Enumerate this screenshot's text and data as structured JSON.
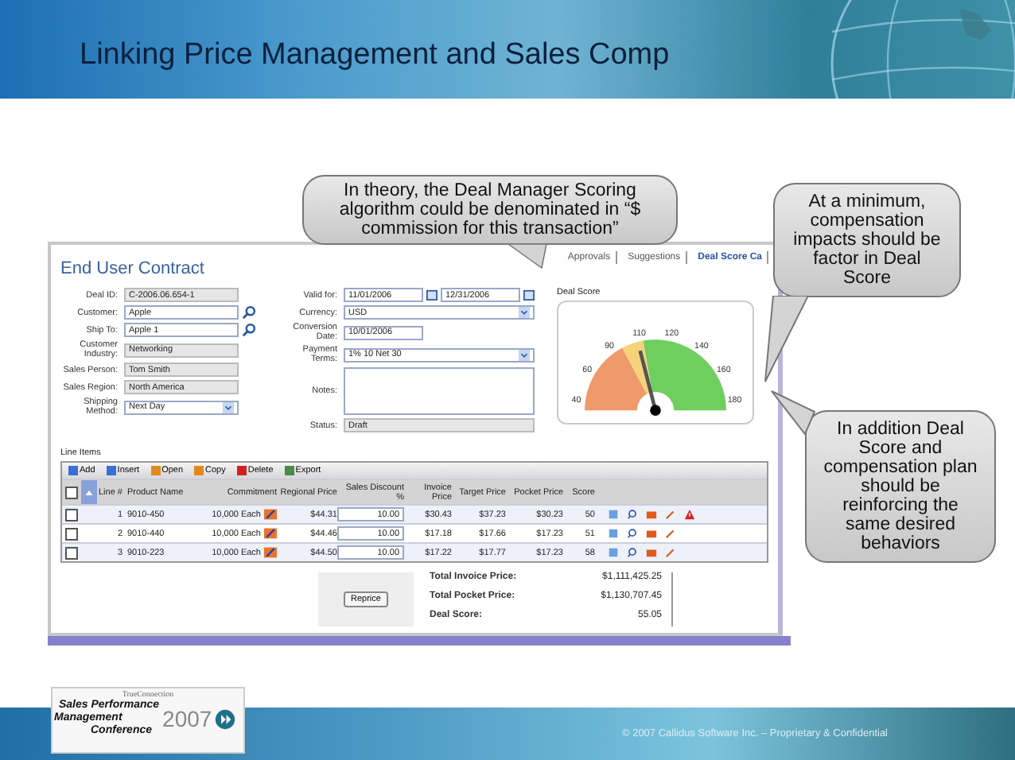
{
  "slide": {
    "title": "Linking Price Management and Sales Comp",
    "footer": "© 2007 Callidus Software Inc. – Proprietary & Confidential"
  },
  "logo": {
    "brand": "TrueConnection",
    "lines": [
      "Sales Performance",
      "Management",
      "Conference"
    ],
    "year": "2007"
  },
  "contract": {
    "title": "End User Contract",
    "tabs": [
      {
        "label": "Approvals",
        "selected": false
      },
      {
        "label": "Suggestions",
        "selected": false
      },
      {
        "label": "Deal Score Ca",
        "selected": true
      }
    ],
    "left_fields": [
      {
        "label": "Deal ID:",
        "value": "C-2006.06.654-1",
        "kind": "readonly"
      },
      {
        "label": "Customer:",
        "value": "Apple",
        "kind": "lookup"
      },
      {
        "label": "Ship To:",
        "value": "Apple 1",
        "kind": "lookup"
      },
      {
        "label": "Customer Industry:",
        "value": "Networking",
        "kind": "readonly"
      },
      {
        "label": "Sales Person:",
        "value": "Tom Smith",
        "kind": "readonly"
      },
      {
        "label": "Sales Region:",
        "value": "North America",
        "kind": "readonly"
      },
      {
        "label": "Shipping Method:",
        "value": "Next Day",
        "kind": "select"
      }
    ],
    "right_fields": [
      {
        "label": "Valid for:",
        "value": "11/01/2006",
        "value2": "12/31/2006",
        "kind": "daterange"
      },
      {
        "label": "Currency:",
        "value": "USD",
        "kind": "select"
      },
      {
        "label": "Conversion Date:",
        "value": "10/01/2006",
        "kind": "date"
      },
      {
        "label": "Payment Terms:",
        "value": "1% 10 Net 30",
        "kind": "select"
      },
      {
        "label": "Notes:",
        "kind": "textarea"
      },
      {
        "label": "Status:",
        "value": "Draft",
        "kind": "readonly"
      }
    ],
    "gauge": {
      "title": "Deal Score",
      "ticks": [
        "40",
        "60",
        "90",
        "110",
        "120",
        "140",
        "160",
        "180"
      ],
      "level": 0.42
    },
    "line_items": {
      "title": "Line Items",
      "toolbar": [
        {
          "label": "Add",
          "kind": "add"
        },
        {
          "label": "Insert",
          "kind": "insert"
        },
        {
          "label": "Open",
          "kind": "open"
        },
        {
          "label": "Copy",
          "kind": "copy"
        },
        {
          "label": "Delete",
          "kind": "delete"
        },
        {
          "label": "Export",
          "kind": "export"
        }
      ],
      "all_checked": false,
      "columns": [
        "Line #",
        "Product Name",
        "Commitment",
        "Regional Price",
        "Sales Discount %",
        "Invoice Price",
        "Target Price",
        "Pocket Price",
        "Score"
      ],
      "rows": [
        {
          "checked": false,
          "warning": true,
          "cells": [
            "1",
            "9010-450",
            "10,000 Each",
            "$44.31",
            "10.00",
            "$30.43",
            "$37.23",
            "$30.23",
            "50"
          ]
        },
        {
          "checked": false,
          "warning": false,
          "cells": [
            "2",
            "9010-440",
            "10,000 Each",
            "$44.46",
            "10.00",
            "$17.18",
            "$17.66",
            "$17.23",
            "51"
          ]
        },
        {
          "checked": false,
          "warning": false,
          "cells": [
            "3",
            "9010-223",
            "10,000 Each",
            "$44.50",
            "10.00",
            "$17.22",
            "$17.77",
            "$17.23",
            "58"
          ]
        }
      ]
    },
    "button": "Reprice",
    "totals": [
      {
        "label": "Total Invoice Price:",
        "value": "$1,111,425.25"
      },
      {
        "label": "Total Pocket Price:",
        "value": "$1,130,707.45"
      },
      {
        "label": "Deal Score:",
        "value": "55.05"
      }
    ]
  },
  "callouts": [
    {
      "text": "In theory, the Deal Manager Scoring algorithm could be denominated in “$ commission for this transaction”"
    },
    {
      "text": "At a minimum, compensation impacts should be factor in Deal Score"
    },
    {
      "text": "In addition Deal Score and compensation plan should be reinforcing the same desired behaviors"
    }
  ]
}
